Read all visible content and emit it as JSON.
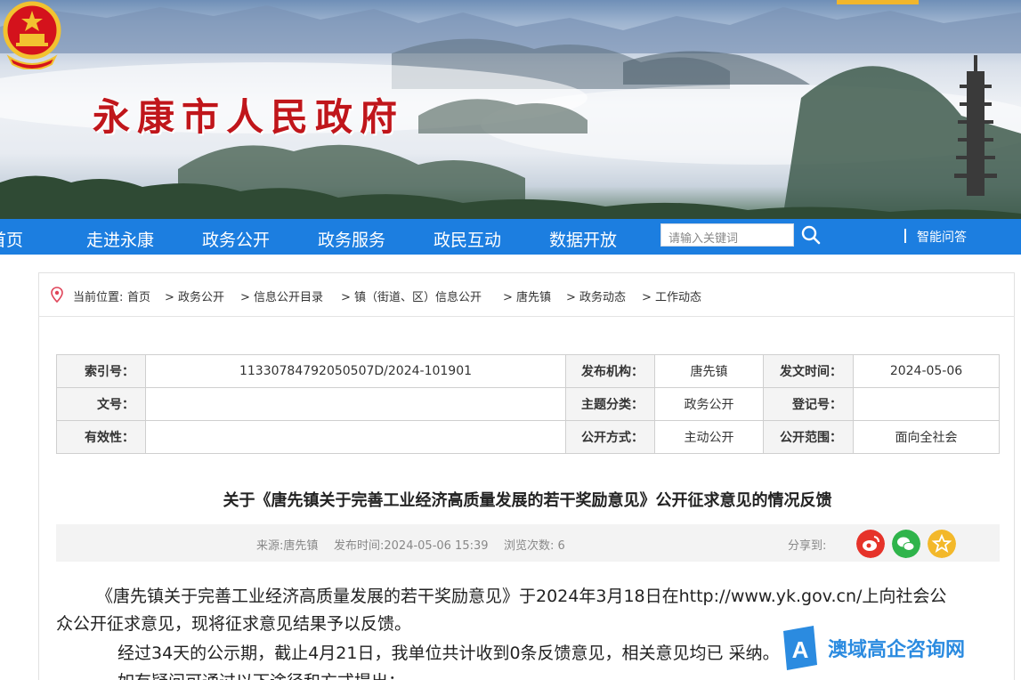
{
  "header": {
    "site_title": "永康市人民政府",
    "emblem_icon": "national-emblem-icon",
    "accent_color": "#c0161b"
  },
  "nav": {
    "items": [
      "首页",
      "走进永康",
      "政务公开",
      "政务服务",
      "政民互动",
      "数据开放"
    ],
    "search_placeholder": "请输入关键词",
    "search_icon": "search-icon",
    "ai_label": "智能问答",
    "color": "#1c7ee0"
  },
  "breadcrumb": {
    "prefix": "当前位置:",
    "items": [
      "首页",
      "> 政务公开",
      "> 信息公开目录",
      "> 镇（街道、区）信息公开",
      "> 唐先镇",
      "> 政务动态",
      "> 工作动态"
    ]
  },
  "meta": {
    "index_label": "索引号：",
    "index_value": "11330784792050507D/2024-101901",
    "org_label": "发布机构：",
    "org_value": "唐先镇",
    "date_label": "发文时间：",
    "date_value": "2024-05-06",
    "doc_label": "文号：",
    "doc_value": "",
    "topic_label": "主题分类：",
    "topic_value": "政务公开",
    "reg_label": "登记号：",
    "reg_value": "",
    "valid_label": "有效性：",
    "valid_value": "",
    "mode_label": "公开方式：",
    "mode_value": "主动公开",
    "scope_label": "公开范围：",
    "scope_value": "面向全社会"
  },
  "article": {
    "title": "关于《唐先镇关于完善工业经济高质量发展的若干奖励意见》公开征求意见的情况反馈",
    "source": "来源:唐先镇",
    "published": "发布时间:2024-05-06 15:39",
    "views": "浏览次数: 6",
    "share_label": "分享到:",
    "share_icons": [
      "weibo-icon",
      "wechat-icon",
      "favorite-icon"
    ],
    "para1_line1": "《唐先镇关于完善工业经济高质量发展的若干奖励意见》于2024年3月18日在http://www.yk.gov.cn/上向社会公",
    "para1_line2": "众公开征求意见，现将征求意见结果予以反馈。",
    "para2": "经过34天的公示期，截止4月21日，我单位共计收到0条反馈意见，相关意见均已      采纳。",
    "para3": "如有疑问可通过以下途径和方式提出："
  },
  "watermark": {
    "text": "澳域高企咨询网",
    "icon": "logo-a-icon"
  }
}
